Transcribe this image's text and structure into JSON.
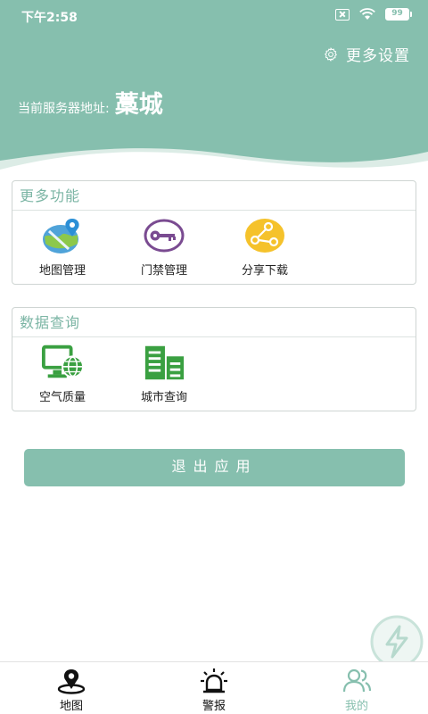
{
  "status_bar": {
    "time": "下午2:58",
    "battery": "99"
  },
  "header": {
    "settings_label": "更多设置",
    "server_label": "当前服务器地址:",
    "server_value": "藁城"
  },
  "more_functions": {
    "title": "更多功能",
    "items": [
      {
        "label": "地图管理",
        "icon": "map-pin-icon"
      },
      {
        "label": "门禁管理",
        "icon": "key-icon"
      },
      {
        "label": "分享下载",
        "icon": "share-icon"
      }
    ]
  },
  "data_query": {
    "title": "数据查询",
    "items": [
      {
        "label": "空气质量",
        "icon": "monitor-globe-icon"
      },
      {
        "label": "城市查询",
        "icon": "buildings-icon"
      }
    ]
  },
  "logout_label": "退出应用",
  "tabs": [
    {
      "label": "地图",
      "icon": "location-icon",
      "active": false
    },
    {
      "label": "警报",
      "icon": "alarm-icon",
      "active": false
    },
    {
      "label": "我的",
      "icon": "users-icon",
      "active": true
    }
  ],
  "colors": {
    "primary": "#86bfae",
    "accent_text": "#7bb5a4",
    "tab_active": "#86bfae"
  }
}
